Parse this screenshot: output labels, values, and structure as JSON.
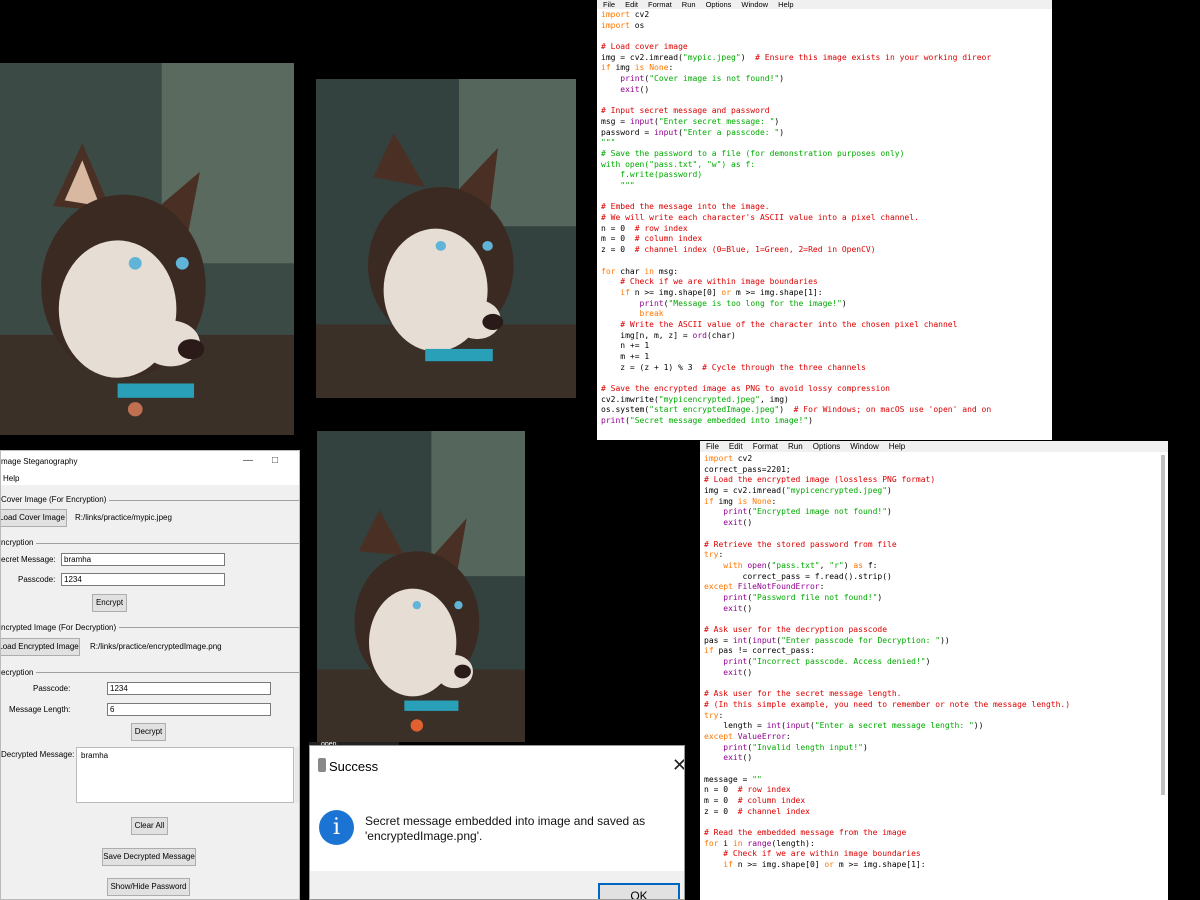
{
  "idle_top": {
    "menu": [
      "File",
      "Edit",
      "Format",
      "Run",
      "Options",
      "Window",
      "Help"
    ],
    "lines": [
      [
        [
          "k",
          "import"
        ],
        [
          "n",
          " cv2"
        ]
      ],
      [
        [
          "k",
          "import"
        ],
        [
          "n",
          " os"
        ]
      ],
      [],
      [
        [
          "c",
          "# Load cover image"
        ]
      ],
      [
        [
          "n",
          "img = cv2.imread("
        ],
        [
          "s",
          "\"mypic.jpeg\""
        ],
        [
          "n",
          ")  "
        ],
        [
          "c",
          "# Ensure this image exists in your working direor"
        ]
      ],
      [
        [
          "k",
          "if"
        ],
        [
          "n",
          " img "
        ],
        [
          "k",
          "is"
        ],
        [
          "n",
          " "
        ],
        [
          "k",
          "None"
        ],
        [
          "n",
          ":"
        ]
      ],
      [
        [
          "n",
          "    "
        ],
        [
          "b",
          "print"
        ],
        [
          "n",
          "("
        ],
        [
          "s",
          "\"Cover image is not found!\""
        ],
        [
          "n",
          ")"
        ]
      ],
      [
        [
          "n",
          "    "
        ],
        [
          "b",
          "exit"
        ],
        [
          "n",
          "()"
        ]
      ],
      [],
      [
        [
          "c",
          "# Input secret message and password"
        ]
      ],
      [
        [
          "n",
          "msg = "
        ],
        [
          "b",
          "input"
        ],
        [
          "n",
          "("
        ],
        [
          "s",
          "\"Enter secret message: \""
        ],
        [
          "n",
          ")"
        ]
      ],
      [
        [
          "n",
          "password = "
        ],
        [
          "b",
          "input"
        ],
        [
          "n",
          "("
        ],
        [
          "s",
          "\"Enter a passcode: \""
        ],
        [
          "n",
          ")"
        ]
      ],
      [
        [
          "s",
          "\"\"\""
        ]
      ],
      [
        [
          "s",
          "# Save the password to a file (for demonstration purposes only)"
        ]
      ],
      [
        [
          "s",
          "with open(\"pass.txt\", \"w\") as f:"
        ]
      ],
      [
        [
          "s",
          "    f.write(password)"
        ]
      ],
      [
        [
          "s",
          "    \"\"\""
        ]
      ],
      [],
      [
        [
          "c",
          "# Embed the message into the image."
        ]
      ],
      [
        [
          "c",
          "# We will write each character's ASCII value into a pixel channel."
        ]
      ],
      [
        [
          "n",
          "n = 0  "
        ],
        [
          "c",
          "# row index"
        ]
      ],
      [
        [
          "n",
          "m = 0  "
        ],
        [
          "c",
          "# column index"
        ]
      ],
      [
        [
          "n",
          "z = 0  "
        ],
        [
          "c",
          "# channel index (0=Blue, 1=Green, 2=Red in OpenCV)"
        ]
      ],
      [],
      [
        [
          "k",
          "for"
        ],
        [
          "n",
          " char "
        ],
        [
          "k",
          "in"
        ],
        [
          "n",
          " msg:"
        ]
      ],
      [
        [
          "n",
          "    "
        ],
        [
          "c",
          "# Check if we are within image boundaries"
        ]
      ],
      [
        [
          "n",
          "    "
        ],
        [
          "k",
          "if"
        ],
        [
          "n",
          " n >= img.shape[0] "
        ],
        [
          "k",
          "or"
        ],
        [
          "n",
          " m >= img.shape[1]:"
        ]
      ],
      [
        [
          "n",
          "        "
        ],
        [
          "b",
          "print"
        ],
        [
          "n",
          "("
        ],
        [
          "s",
          "\"Message is too long for the image!\""
        ],
        [
          "n",
          ")"
        ]
      ],
      [
        [
          "n",
          "        "
        ],
        [
          "k",
          "break"
        ]
      ],
      [
        [
          "n",
          "    "
        ],
        [
          "c",
          "# Write the ASCII value of the character into the chosen pixel channel"
        ]
      ],
      [
        [
          "n",
          "    img[n, m, z] = "
        ],
        [
          "b",
          "ord"
        ],
        [
          "n",
          "(char)"
        ]
      ],
      [
        [
          "n",
          "    n += 1"
        ]
      ],
      [
        [
          "n",
          "    m += 1"
        ]
      ],
      [
        [
          "n",
          "    z = (z + 1) % 3  "
        ],
        [
          "c",
          "# Cycle through the three channels"
        ]
      ],
      [],
      [
        [
          "c",
          "# Save the encrypted image as PNG to avoid lossy compression"
        ]
      ],
      [
        [
          "n",
          "cv2.imwrite("
        ],
        [
          "s",
          "\"mypicencrypted.jpeg\""
        ],
        [
          "n",
          ", img)"
        ]
      ],
      [
        [
          "n",
          "os.system("
        ],
        [
          "s",
          "\"start encryptedImage.jpeg\""
        ],
        [
          "n",
          ")  "
        ],
        [
          "c",
          "# For Windows; on macOS use 'open' and on"
        ]
      ],
      [
        [
          "b",
          "print"
        ],
        [
          "n",
          "("
        ],
        [
          "s",
          "\"Secret message embedded into image!\""
        ],
        [
          "n",
          ")"
        ]
      ]
    ]
  },
  "idle_bottom": {
    "menu": [
      "File",
      "Edit",
      "Format",
      "Run",
      "Options",
      "Window",
      "Help"
    ],
    "lines": [
      [
        [
          "k",
          "import"
        ],
        [
          "n",
          " cv2"
        ]
      ],
      [
        [
          "n",
          "correct_pass=2201;"
        ]
      ],
      [
        [
          "c",
          "# Load the encrypted image (lossless PNG format)"
        ]
      ],
      [
        [
          "n",
          "img = cv2.imread("
        ],
        [
          "s",
          "\"mypicencrypted.jpeg\""
        ],
        [
          "n",
          ")"
        ]
      ],
      [
        [
          "k",
          "if"
        ],
        [
          "n",
          " img "
        ],
        [
          "k",
          "is"
        ],
        [
          "n",
          " "
        ],
        [
          "k",
          "None"
        ],
        [
          "n",
          ":"
        ]
      ],
      [
        [
          "n",
          "    "
        ],
        [
          "b",
          "print"
        ],
        [
          "n",
          "("
        ],
        [
          "s",
          "\"Encrypted image not found!\""
        ],
        [
          "n",
          ")"
        ]
      ],
      [
        [
          "n",
          "    "
        ],
        [
          "b",
          "exit"
        ],
        [
          "n",
          "()"
        ]
      ],
      [],
      [
        [
          "c",
          "# Retrieve the stored password from file"
        ]
      ],
      [
        [
          "k",
          "try"
        ],
        [
          "n",
          ":"
        ]
      ],
      [
        [
          "n",
          "    "
        ],
        [
          "k",
          "with"
        ],
        [
          "n",
          " "
        ],
        [
          "b",
          "open"
        ],
        [
          "n",
          "("
        ],
        [
          "s",
          "\"pass.txt\""
        ],
        [
          "n",
          ", "
        ],
        [
          "s",
          "\"r\""
        ],
        [
          "n",
          ") "
        ],
        [
          "k",
          "as"
        ],
        [
          "n",
          " f:"
        ]
      ],
      [
        [
          "n",
          "        correct_pass = f.read().strip()"
        ]
      ],
      [
        [
          "k",
          "except"
        ],
        [
          "n",
          " "
        ],
        [
          "b",
          "FileNotFoundError"
        ],
        [
          "n",
          ":"
        ]
      ],
      [
        [
          "n",
          "    "
        ],
        [
          "b",
          "print"
        ],
        [
          "n",
          "("
        ],
        [
          "s",
          "\"Password file not found!\""
        ],
        [
          "n",
          ")"
        ]
      ],
      [
        [
          "n",
          "    "
        ],
        [
          "b",
          "exit"
        ],
        [
          "n",
          "()"
        ]
      ],
      [],
      [
        [
          "c",
          "# Ask user for the decryption passcode"
        ]
      ],
      [
        [
          "n",
          "pas = "
        ],
        [
          "b",
          "int"
        ],
        [
          "n",
          "("
        ],
        [
          "b",
          "input"
        ],
        [
          "n",
          "("
        ],
        [
          "s",
          "\"Enter passcode for Decryption: \""
        ],
        [
          "n",
          "))"
        ]
      ],
      [
        [
          "k",
          "if"
        ],
        [
          "n",
          " pas != correct_pass:"
        ]
      ],
      [
        [
          "n",
          "    "
        ],
        [
          "b",
          "print"
        ],
        [
          "n",
          "("
        ],
        [
          "s",
          "\"Incorrect passcode. Access denied!\""
        ],
        [
          "n",
          ")"
        ]
      ],
      [
        [
          "n",
          "    "
        ],
        [
          "b",
          "exit"
        ],
        [
          "n",
          "()"
        ]
      ],
      [],
      [
        [
          "c",
          "# Ask user for the secret message length."
        ]
      ],
      [
        [
          "c",
          "# (In this simple example, you need to remember or note the message length.)"
        ]
      ],
      [
        [
          "k",
          "try"
        ],
        [
          "n",
          ":"
        ]
      ],
      [
        [
          "n",
          "    length = "
        ],
        [
          "b",
          "int"
        ],
        [
          "n",
          "("
        ],
        [
          "b",
          "input"
        ],
        [
          "n",
          "("
        ],
        [
          "s",
          "\"Enter a secret message length: \""
        ],
        [
          "n",
          "))"
        ]
      ],
      [
        [
          "k",
          "except"
        ],
        [
          "n",
          " "
        ],
        [
          "b",
          "ValueError"
        ],
        [
          "n",
          ":"
        ]
      ],
      [
        [
          "n",
          "    "
        ],
        [
          "b",
          "print"
        ],
        [
          "n",
          "("
        ],
        [
          "s",
          "\"Invalid length input!\""
        ],
        [
          "n",
          ")"
        ]
      ],
      [
        [
          "n",
          "    "
        ],
        [
          "b",
          "exit"
        ],
        [
          "n",
          "()"
        ]
      ],
      [],
      [
        [
          "n",
          "message = "
        ],
        [
          "s",
          "\"\""
        ]
      ],
      [
        [
          "n",
          "n = 0  "
        ],
        [
          "c",
          "# row index"
        ]
      ],
      [
        [
          "n",
          "m = 0  "
        ],
        [
          "c",
          "# column index"
        ]
      ],
      [
        [
          "n",
          "z = 0  "
        ],
        [
          "c",
          "# channel index"
        ]
      ],
      [],
      [
        [
          "c",
          "# Read the embedded message from the image"
        ]
      ],
      [
        [
          "k",
          "for"
        ],
        [
          "n",
          " i "
        ],
        [
          "k",
          "in"
        ],
        [
          "n",
          " "
        ],
        [
          "b",
          "range"
        ],
        [
          "n",
          "(length):"
        ]
      ],
      [
        [
          "n",
          "    "
        ],
        [
          "c",
          "# Check if we are within image boundaries"
        ]
      ],
      [
        [
          "n",
          "    "
        ],
        [
          "k",
          "if"
        ],
        [
          "n",
          " n >= img.shape[0] "
        ],
        [
          "k",
          "or"
        ],
        [
          "n",
          " m >= img.shape[1]:"
        ]
      ]
    ]
  },
  "app": {
    "title": "mage Steganography",
    "menu_help": "Help",
    "cover_section": "Cover Image (For Encryption)",
    "load_cover_button": "Load Cover Image",
    "cover_path": "R:/links/practice/mypic.jpeg",
    "encryption_section": "ncryption",
    "secret_message_label": "ecret Message:",
    "secret_message_value": "bramha",
    "passcode_label": "Passcode:",
    "passcode_value": "1234",
    "encrypt_button": "Encrypt",
    "encrypted_section": "ncrypted Image (For Decryption)",
    "load_encrypted_button": "Load Encrypted Image",
    "encrypted_path": "R:/links/practice/encryptedImage.png",
    "decryption_section": "ecryption",
    "dec_passcode_label": "Passcode:",
    "dec_passcode_value": "1234",
    "message_length_label": "Message Length:",
    "message_length_value": "6",
    "decrypt_button": "Decrypt",
    "decrypted_message_label": "Decrypted Message:",
    "decrypted_message_value": "bramha",
    "clear_all_button": "Clear All",
    "save_decrypted_button": "Save Decrypted Message",
    "show_hide_button": "Show/Hide Password"
  },
  "dialog": {
    "behind_text": "open",
    "title": "Success",
    "message_line1": "Secret message embedded into image and saved as",
    "message_line2": "'encryptedImage.png'.",
    "ok_button": "OK",
    "icon_glyph": "i"
  },
  "colors": {
    "keyword": "#ff7700",
    "builtin": "#900090",
    "string": "#00aa00",
    "comment": "#dd0000",
    "info_icon": "#1b74d4"
  }
}
